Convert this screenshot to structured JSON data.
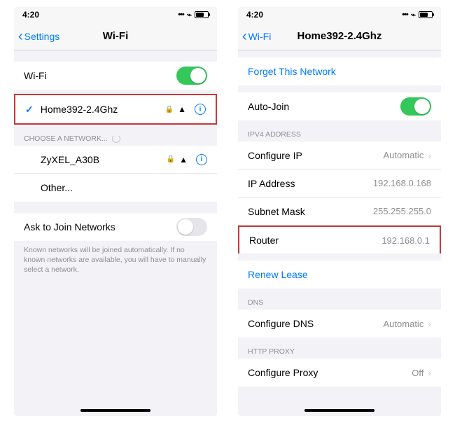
{
  "statusbar": {
    "time": "4:20",
    "loc_glyph": "➤"
  },
  "left": {
    "back": "Settings",
    "title": "Wi-Fi",
    "wifi_label": "Wi-Fi",
    "connected": {
      "name": "Home392-2.4Ghz"
    },
    "choose_header": "CHOOSE A NETWORK...",
    "networks": [
      {
        "name": "ZyXEL_A30B"
      }
    ],
    "other": "Other...",
    "ask_label": "Ask to Join Networks",
    "ask_footer": "Known networks will be joined automatically. If no known networks are available, you will have to manually select a network."
  },
  "right": {
    "back": "Wi-Fi",
    "title": "Home392-2.4Ghz",
    "forget": "Forget This Network",
    "autojoin": "Auto-Join",
    "ipv4_header": "IPV4 ADDRESS",
    "ipv4": {
      "configure_label": "Configure IP",
      "configure_value": "Automatic",
      "ip_label": "IP Address",
      "ip_value": "192.168.0.168",
      "subnet_label": "Subnet Mask",
      "subnet_value": "255.255.255.0",
      "router_label": "Router",
      "router_value": "192.168.0.1"
    },
    "renew": "Renew Lease",
    "dns_header": "DNS",
    "dns_label": "Configure DNS",
    "dns_value": "Automatic",
    "proxy_header": "HTTP PROXY",
    "proxy_label": "Configure Proxy",
    "proxy_value": "Off"
  }
}
